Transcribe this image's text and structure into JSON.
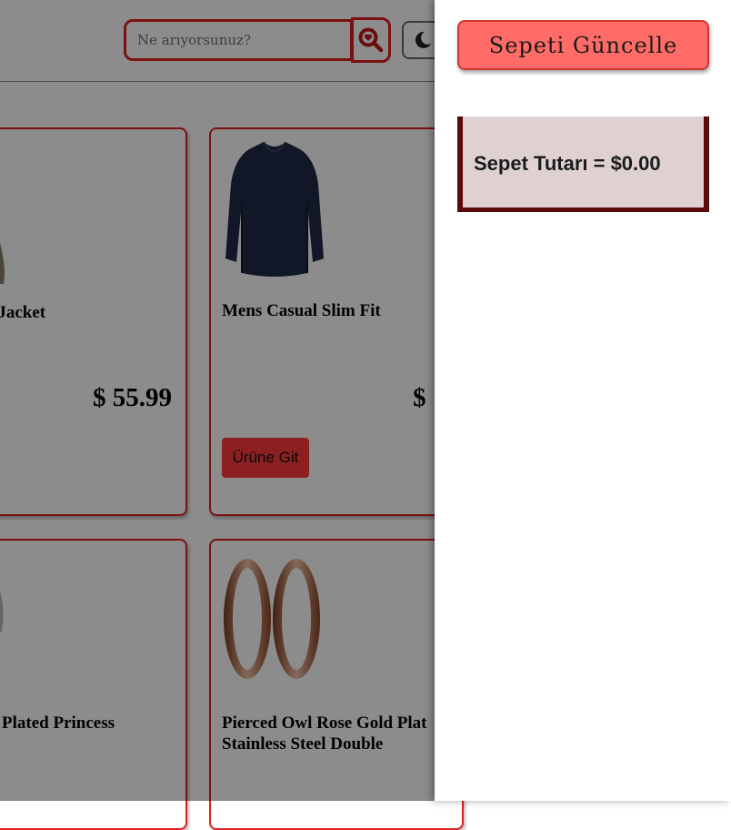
{
  "header": {
    "search": {
      "placeholder": "Ne arıyorsunuz?",
      "value": ""
    },
    "icons": {
      "search": "search-heart-icon",
      "theme": "moon-icon"
    }
  },
  "products": [
    {
      "title": "n Jacket",
      "price": "$ 55.99",
      "button": ""
    },
    {
      "title": "Mens Casual Slim Fit",
      "price": "$",
      "button": "Ürüne Git",
      "image": "navy-long-sleeve-shirt"
    },
    {
      "title": "Plated Princess",
      "price": "",
      "button": ""
    },
    {
      "title": "Pierced Owl Rose Gold Plat Stainless Steel Double",
      "price": "",
      "button": "",
      "image": "rose-gold-tunnel-earrings"
    }
  ],
  "cart": {
    "update_button": "Sepeti Güncelle",
    "total_label": "Sepet Tutarı = $0.00"
  },
  "colors": {
    "accent_red": "#e02020",
    "button_red": "#ff6b66",
    "total_border": "#5a0a0a",
    "total_bg": "#dfd1d1"
  }
}
